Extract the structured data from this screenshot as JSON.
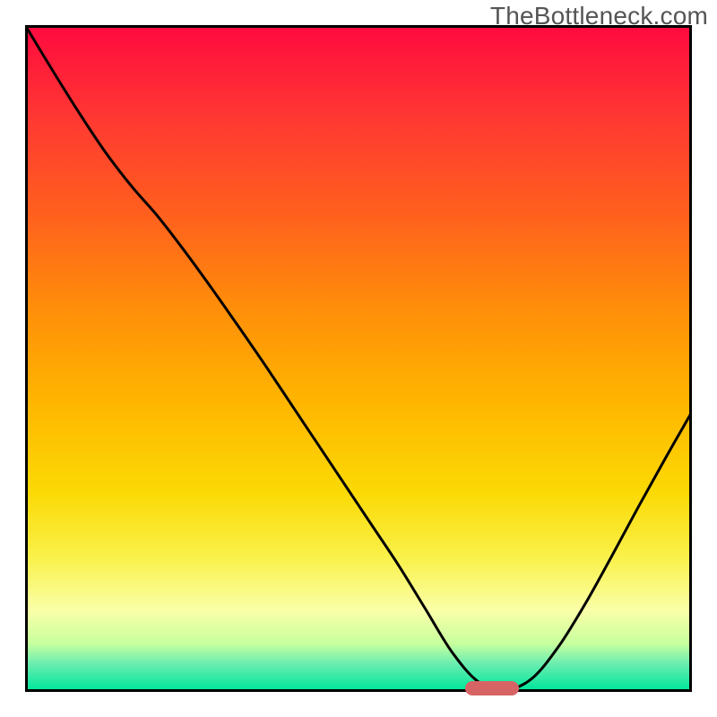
{
  "watermark": "TheBottleneck.com",
  "colors": {
    "border": "#000000",
    "curve": "#000000",
    "marker": "#d76464",
    "gradient_stops": [
      {
        "offset": 0.0,
        "color": "#ff0a3f"
      },
      {
        "offset": 0.14,
        "color": "#ff3932"
      },
      {
        "offset": 0.28,
        "color": "#ff5f1e"
      },
      {
        "offset": 0.42,
        "color": "#ff8d0a"
      },
      {
        "offset": 0.56,
        "color": "#ffb400"
      },
      {
        "offset": 0.7,
        "color": "#fbd904"
      },
      {
        "offset": 0.8,
        "color": "#faf14a"
      },
      {
        "offset": 0.88,
        "color": "#faffa8"
      },
      {
        "offset": 0.93,
        "color": "#c7ff9e"
      },
      {
        "offset": 0.96,
        "color": "#6bedb0"
      },
      {
        "offset": 1.0,
        "color": "#00e69c"
      }
    ]
  },
  "chart_data": {
    "type": "line",
    "title": "",
    "xlabel": "",
    "ylabel": "",
    "xlim": [
      0,
      100
    ],
    "ylim": [
      0,
      100
    ],
    "series": [
      {
        "name": "bottleneck-curve",
        "x": [
          0.0,
          4.0,
          8.0,
          12.0,
          16.0,
          20.0,
          24.0,
          28.0,
          32.0,
          36.0,
          40.0,
          44.0,
          48.0,
          52.0,
          56.0,
          60.0,
          64.0,
          68.0,
          72.0,
          76.0,
          80.0,
          84.0,
          88.0,
          92.0,
          96.0,
          100.0
        ],
        "values": [
          100.0,
          93.4,
          87.0,
          81.0,
          75.8,
          71.2,
          66.0,
          60.5,
          54.8,
          49.0,
          43.0,
          37.0,
          31.0,
          25.0,
          19.0,
          12.5,
          6.0,
          1.5,
          0.3,
          2.0,
          6.8,
          13.2,
          20.4,
          27.8,
          35.0,
          42.0
        ]
      }
    ],
    "marker": {
      "name": "optimal-range",
      "x_start": 66.0,
      "x_end": 74.0,
      "y": 0.5
    },
    "notes": "Curve depicts bottleneck percentage as a function of an unlabeled x-axis parameter. Minimum (≈0) lies around x≈70, highlighted by a small rounded bar marker. Background vertical gradient runs from red/pink at top (high value) through orange and yellow to green at bottom (low value)."
  }
}
